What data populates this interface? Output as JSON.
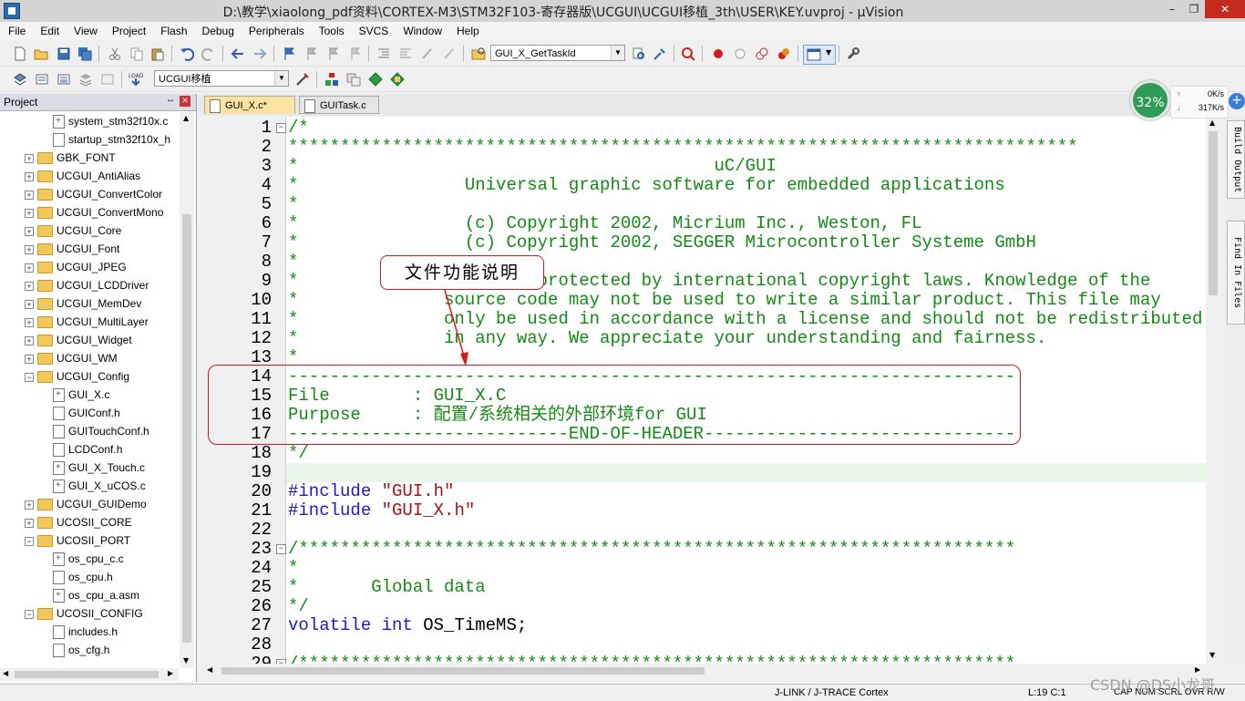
{
  "window": {
    "title": "D:\\教学\\xiaolong_pdf资料\\CORTEX-M3\\STM32F103-寄存器版\\UCGUI\\UCGUI移植_3th\\USER\\KEY.uvproj - µVision",
    "min": "–",
    "max": "❐",
    "close": "✕"
  },
  "menu": [
    "File",
    "Edit",
    "View",
    "Project",
    "Flash",
    "Debug",
    "Peripherals",
    "Tools",
    "SVCS",
    "Window",
    "Help"
  ],
  "toolbar": {
    "find_combo": "GUI_X_GetTaskId",
    "target_combo": "UCGUI移植"
  },
  "project_panel": {
    "title": "Project",
    "pin": "↔",
    "close": "✕",
    "rows": [
      {
        "label": "system_stm32f10x.c",
        "indent": 2,
        "kind": "file",
        "plus": true
      },
      {
        "label": "startup_stm32f10x_h",
        "indent": 2,
        "kind": "file",
        "plus": false
      },
      {
        "label": "GBK_FONT",
        "indent": 1,
        "kind": "folder",
        "exp": "+"
      },
      {
        "label": "UCGUI_AntiAlias",
        "indent": 1,
        "kind": "folder",
        "exp": "+"
      },
      {
        "label": "UCGUI_ConvertColor",
        "indent": 1,
        "kind": "folder",
        "exp": "+"
      },
      {
        "label": "UCGUI_ConvertMono",
        "indent": 1,
        "kind": "folder",
        "exp": "+"
      },
      {
        "label": "UCGUI_Core",
        "indent": 1,
        "kind": "folder",
        "exp": "+"
      },
      {
        "label": "UCGUI_Font",
        "indent": 1,
        "kind": "folder",
        "exp": "+"
      },
      {
        "label": "UCGUI_JPEG",
        "indent": 1,
        "kind": "folder",
        "exp": "+"
      },
      {
        "label": "UCGUI_LCDDriver",
        "indent": 1,
        "kind": "folder",
        "exp": "+"
      },
      {
        "label": "UCGUI_MemDev",
        "indent": 1,
        "kind": "folder",
        "exp": "+"
      },
      {
        "label": "UCGUI_MultiLayer",
        "indent": 1,
        "kind": "folder",
        "exp": "+"
      },
      {
        "label": "UCGUI_Widget",
        "indent": 1,
        "kind": "folder",
        "exp": "+"
      },
      {
        "label": "UCGUI_WM",
        "indent": 1,
        "kind": "folder",
        "exp": "+"
      },
      {
        "label": "UCGUI_Config",
        "indent": 1,
        "kind": "folder",
        "exp": "−"
      },
      {
        "label": "GUI_X.c",
        "indent": 2,
        "kind": "file",
        "plus": true
      },
      {
        "label": "GUIConf.h",
        "indent": 2,
        "kind": "file",
        "plus": false
      },
      {
        "label": "GUITouchConf.h",
        "indent": 2,
        "kind": "file",
        "plus": false
      },
      {
        "label": "LCDConf.h",
        "indent": 2,
        "kind": "file",
        "plus": false
      },
      {
        "label": "GUI_X_Touch.c",
        "indent": 2,
        "kind": "file",
        "plus": true
      },
      {
        "label": "GUI_X_uCOS.c",
        "indent": 2,
        "kind": "file",
        "plus": true
      },
      {
        "label": "UCGUI_GUIDemo",
        "indent": 1,
        "kind": "folder",
        "exp": "+"
      },
      {
        "label": "UCOSII_CORE",
        "indent": 1,
        "kind": "folder",
        "exp": "+"
      },
      {
        "label": "UCOSII_PORT",
        "indent": 1,
        "kind": "folder",
        "exp": "−"
      },
      {
        "label": "os_cpu_c.c",
        "indent": 2,
        "kind": "file",
        "plus": true
      },
      {
        "label": "os_cpu.h",
        "indent": 2,
        "kind": "file",
        "plus": false
      },
      {
        "label": "os_cpu_a.asm",
        "indent": 2,
        "kind": "file",
        "plus": true
      },
      {
        "label": "UCOSII_CONFIG",
        "indent": 1,
        "kind": "folder",
        "exp": "−"
      },
      {
        "label": "includes.h",
        "indent": 2,
        "kind": "file",
        "plus": false
      },
      {
        "label": "os_cfg.h",
        "indent": 2,
        "kind": "file",
        "plus": false
      }
    ]
  },
  "tabs": [
    {
      "label": "GUI_X.c*",
      "active": true
    },
    {
      "label": "GUITask.c",
      "active": false
    }
  ],
  "code_lines": [
    {
      "n": "1",
      "fold": "−",
      "segs": [
        [
          "cm",
          "/*"
        ]
      ]
    },
    {
      "n": "2",
      "fold": "",
      "segs": [
        [
          "cm",
          "****************************************************************************"
        ]
      ]
    },
    {
      "n": "3",
      "fold": "",
      "segs": [
        [
          "cm",
          "*                                        uC/GUI"
        ]
      ]
    },
    {
      "n": "4",
      "fold": "",
      "segs": [
        [
          "cm",
          "*                Universal graphic software for embedded applications"
        ]
      ]
    },
    {
      "n": "5",
      "fold": "",
      "segs": [
        [
          "cm",
          "*"
        ]
      ]
    },
    {
      "n": "6",
      "fold": "",
      "segs": [
        [
          "cm",
          "*                (c) Copyright 2002, Micrium Inc., Weston, FL"
        ]
      ]
    },
    {
      "n": "7",
      "fold": "",
      "segs": [
        [
          "cm",
          "*                (c) Copyright 2002, SEGGER Microcontroller Systeme GmbH"
        ]
      ]
    },
    {
      "n": "8",
      "fold": "",
      "segs": [
        [
          "cm",
          "*"
        ]
      ]
    },
    {
      "n": "9",
      "fold": "",
      "segs": [
        [
          "cm",
          "*              C/GUI is protected by international copyright laws. Knowledge of the"
        ]
      ]
    },
    {
      "n": "10",
      "fold": "",
      "segs": [
        [
          "cm",
          "*              source code may not be used to write a similar product. This file may"
        ]
      ]
    },
    {
      "n": "11",
      "fold": "",
      "segs": [
        [
          "cm",
          "*              only be used in accordance with a license and should not be redistributed"
        ]
      ]
    },
    {
      "n": "12",
      "fold": "",
      "segs": [
        [
          "cm",
          "*              in any way. We appreciate your understanding and fairness."
        ]
      ]
    },
    {
      "n": "13",
      "fold": "",
      "segs": [
        [
          "cm",
          "*"
        ]
      ]
    },
    {
      "n": "14",
      "fold": "",
      "segs": [
        [
          "cm",
          "----------------------------------------------------------------------"
        ]
      ]
    },
    {
      "n": "15",
      "fold": "",
      "segs": [
        [
          "cm",
          "File        : GUI_X.C"
        ]
      ]
    },
    {
      "n": "16",
      "fold": "",
      "segs": [
        [
          "cm",
          "Purpose     : 配置/系统相关的外部环境for GUI"
        ]
      ]
    },
    {
      "n": "17",
      "fold": "",
      "segs": [
        [
          "cm",
          "---------------------------END-OF-HEADER------------------------------"
        ]
      ]
    },
    {
      "n": "18",
      "fold": "",
      "segs": [
        [
          "cm",
          "*/"
        ]
      ]
    },
    {
      "n": "19",
      "fold": "",
      "segs": [
        [
          "pl",
          ""
        ]
      ]
    },
    {
      "n": "20",
      "fold": "",
      "segs": [
        [
          "kw",
          "#include "
        ],
        [
          "str",
          "\"GUI.h\""
        ]
      ]
    },
    {
      "n": "21",
      "fold": "",
      "segs": [
        [
          "kw",
          "#include "
        ],
        [
          "str",
          "\"GUI_X.h\""
        ]
      ]
    },
    {
      "n": "22",
      "fold": "",
      "segs": [
        [
          "pl",
          ""
        ]
      ]
    },
    {
      "n": "23",
      "fold": "−",
      "segs": [
        [
          "cm",
          "/*********************************************************************"
        ]
      ]
    },
    {
      "n": "24",
      "fold": "",
      "segs": [
        [
          "cm",
          "*"
        ]
      ]
    },
    {
      "n": "25",
      "fold": "",
      "segs": [
        [
          "cm",
          "*       Global data"
        ]
      ]
    },
    {
      "n": "26",
      "fold": "",
      "segs": [
        [
          "cm",
          "*/"
        ]
      ]
    },
    {
      "n": "27",
      "fold": "",
      "segs": [
        [
          "kw",
          "volatile "
        ],
        [
          "kw",
          "int "
        ],
        [
          "pl",
          "OS_TimeMS;"
        ]
      ]
    },
    {
      "n": "28",
      "fold": "",
      "segs": [
        [
          "pl",
          ""
        ]
      ]
    },
    {
      "n": "29",
      "fold": "−",
      "segs": [
        [
          "cm",
          "/*********************************************************************"
        ]
      ]
    }
  ],
  "annotation": "文件功能说明",
  "side_tabs": [
    "Build Output",
    "Find In Files"
  ],
  "net_widget": {
    "percent": "32%",
    "up": "0K/s",
    "down": "317K/s",
    "up_arrow": "↑",
    "down_arrow": "↓",
    "plus": "+"
  },
  "status": {
    "debugger": "J-LINK / J-TRACE Cortex",
    "pos": "L:19 C:1",
    "flags": "CAP  NUM  SCRL  OVR  R/W"
  },
  "watermark": "CSDN @DS小龙哥",
  "colors": {
    "comment": "#138a13",
    "keyword": "#1a1acc",
    "string": "#a31515",
    "annotation": "#d21a1a",
    "current_line": "#e8f6ea"
  }
}
